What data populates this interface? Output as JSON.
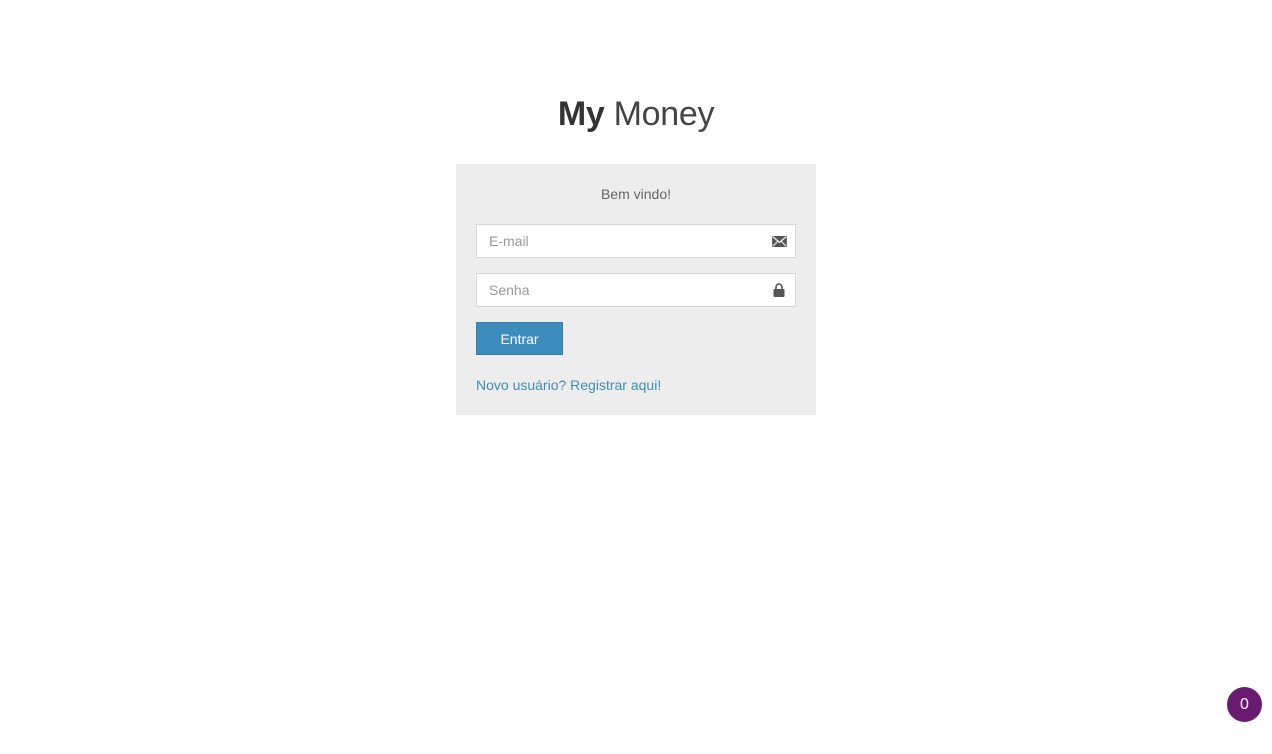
{
  "logo": {
    "strong": "My",
    "light": "Money"
  },
  "login": {
    "message": "Bem vindo!",
    "email": {
      "placeholder": "E-mail",
      "value": "",
      "icon": "envelope-icon"
    },
    "password": {
      "placeholder": "Senha",
      "value": "",
      "icon": "lock-icon"
    },
    "submit_label": "Entrar",
    "register_link": "Novo usuário? Registrar aqui!"
  },
  "badge": {
    "count": "0"
  },
  "colors": {
    "accent": "#3c8dbc",
    "box_background": "#ededed",
    "badge_background": "#6b1a72"
  }
}
